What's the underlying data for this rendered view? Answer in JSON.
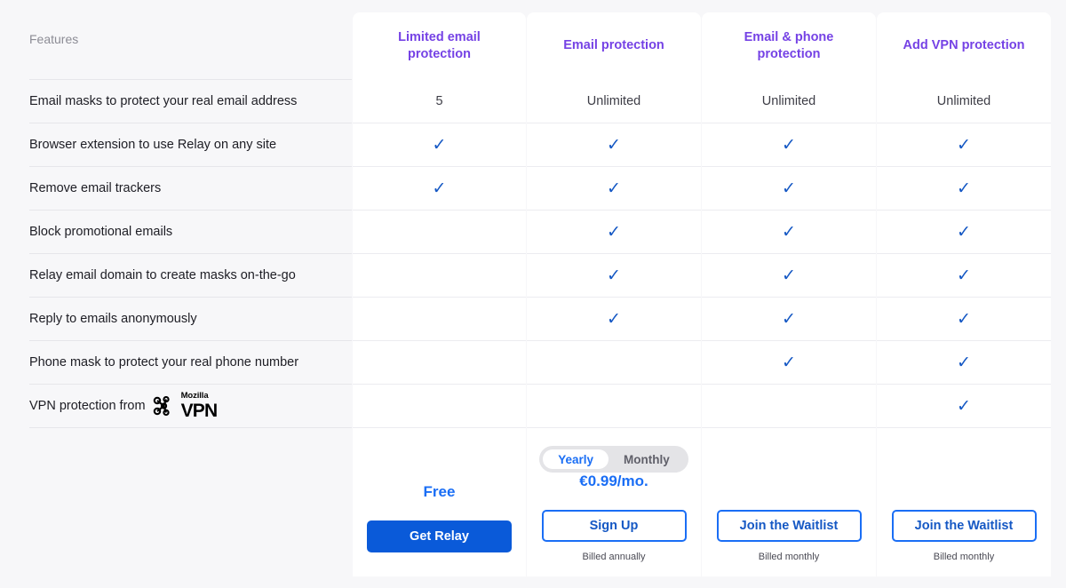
{
  "table": {
    "features_header": "Features",
    "plans": [
      {
        "name": "Limited email protection"
      },
      {
        "name": "Email protection"
      },
      {
        "name": "Email & phone protection"
      },
      {
        "name": "Add VPN protection"
      }
    ],
    "rows": [
      {
        "label": "Email masks to protect your real email address",
        "values": [
          "5",
          "Unlimited",
          "Unlimited",
          "Unlimited"
        ]
      },
      {
        "label": "Browser extension to use Relay on any site",
        "values": [
          "check",
          "check",
          "check",
          "check"
        ]
      },
      {
        "label": "Remove email trackers",
        "values": [
          "check",
          "check",
          "check",
          "check"
        ]
      },
      {
        "label": "Block promotional emails",
        "values": [
          "",
          "check",
          "check",
          "check"
        ]
      },
      {
        "label": "Relay email domain to create masks on-the-go",
        "values": [
          "",
          "check",
          "check",
          "check"
        ]
      },
      {
        "label": "Reply to emails anonymously",
        "values": [
          "",
          "check",
          "check",
          "check"
        ]
      },
      {
        "label": "Phone mask to protect your real phone number",
        "values": [
          "",
          "",
          "check",
          "check"
        ]
      },
      {
        "label": "VPN protection from",
        "logo": {
          "top": "Mozilla",
          "bottom": "VPN"
        },
        "values": [
          "",
          "",
          "",
          "check"
        ]
      }
    ]
  },
  "footers": [
    {
      "price": "Free",
      "cta": "Get Relay",
      "cta_style": "solid",
      "billed": "",
      "toggle": null
    },
    {
      "price": "€0.99/mo.",
      "cta": "Sign Up",
      "cta_style": "outline",
      "billed": "Billed annually",
      "toggle": {
        "yearly": "Yearly",
        "monthly": "Monthly",
        "selected": "Yearly"
      }
    },
    {
      "price": "",
      "cta": "Join the Waitlist",
      "cta_style": "outline",
      "billed": "Billed monthly",
      "toggle": null
    },
    {
      "price": "",
      "cta": "Join the Waitlist",
      "cta_style": "outline",
      "billed": "Billed monthly",
      "toggle": null
    }
  ],
  "colors": {
    "plan_header": "#7542e5",
    "check": "#1558c4",
    "accent_blue": "#1a6ef5",
    "solid_button": "#0a5ad9",
    "page_background": "#f7f7f9"
  },
  "icons": {
    "check": "✓"
  }
}
